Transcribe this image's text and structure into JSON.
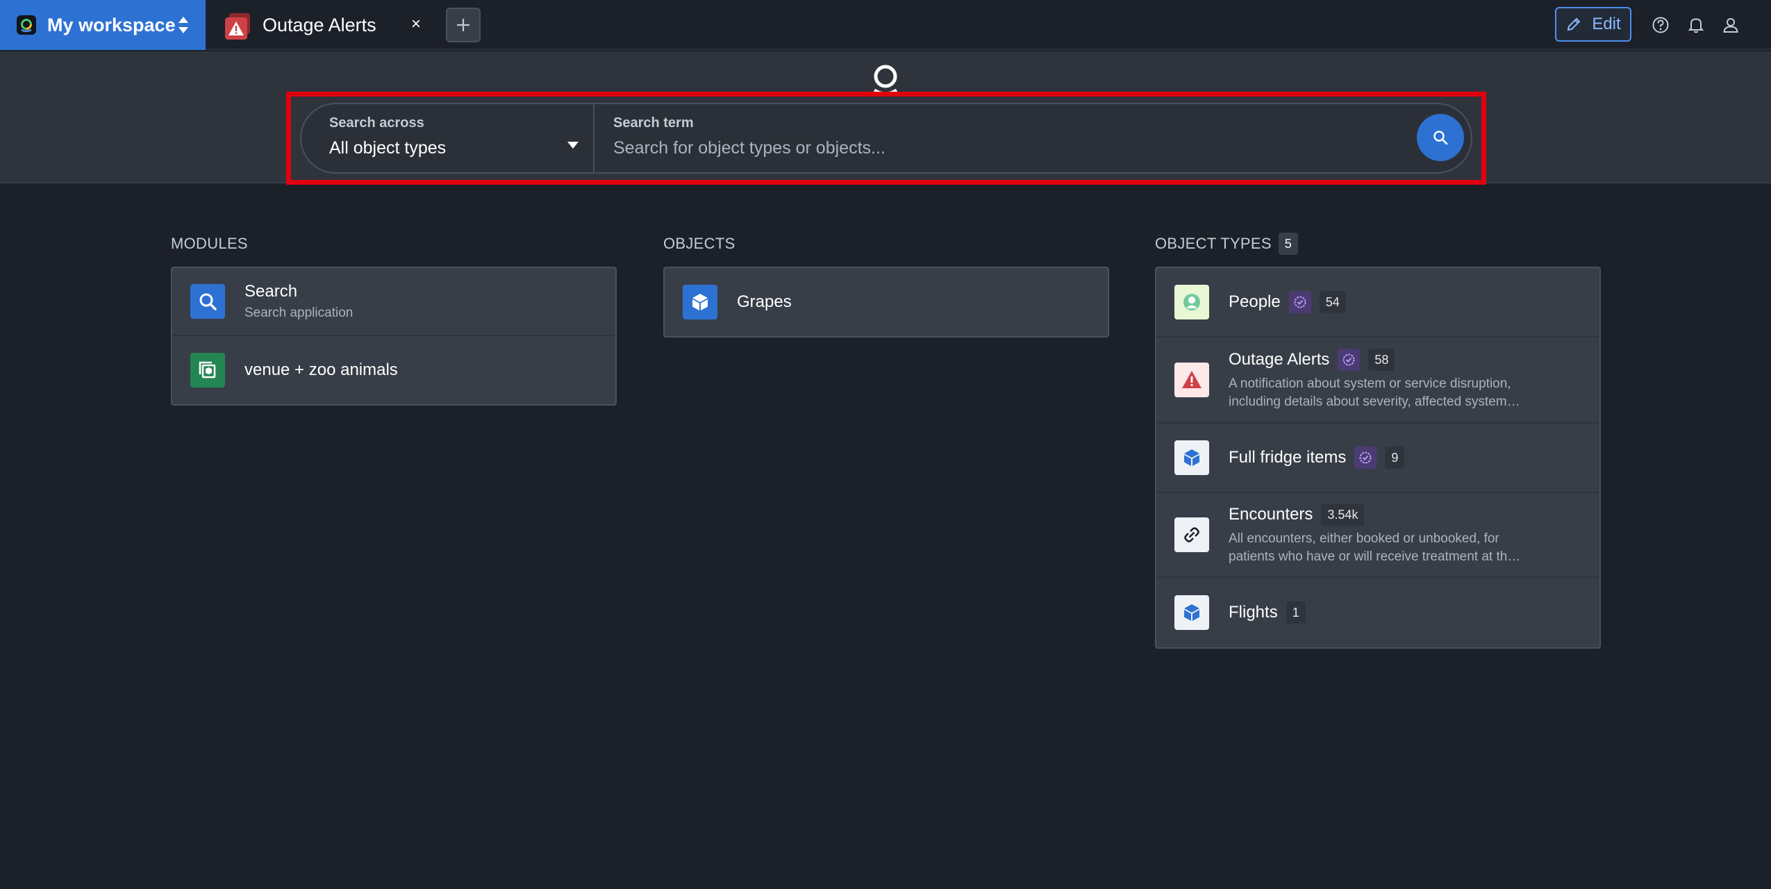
{
  "topbar": {
    "workspace_title": "My workspace",
    "tab_title": "Outage Alerts",
    "tab_close": "×",
    "new_tab": "+",
    "edit_label": "Edit"
  },
  "search": {
    "scope_label": "Search across",
    "scope_value": "All object types",
    "term_label": "Search term",
    "term_placeholder": "Search for object types or objects...",
    "term_value": ""
  },
  "modules": {
    "heading": "MODULES",
    "items": [
      {
        "title": "Search",
        "subtitle": "Search application",
        "icon": "search-icon",
        "color": "#2d72d2"
      },
      {
        "title": "venue + zoo animals",
        "icon": "module-icon",
        "color": "#238551"
      }
    ]
  },
  "objects": {
    "heading": "OBJECTS",
    "items": [
      {
        "title": "Grapes",
        "icon": "cube-icon",
        "color": "#2d72d2"
      }
    ]
  },
  "object_types": {
    "heading": "OBJECT TYPES",
    "count": "5",
    "items": [
      {
        "title": "People",
        "verified": true,
        "count": "54",
        "icon": "person-icon"
      },
      {
        "title": "Outage Alerts",
        "verified": true,
        "count": "58",
        "icon": "warning-icon",
        "description_line1": "A notification about system or service disruption,",
        "description_line2": "including details about severity, affected system…"
      },
      {
        "title": "Full fridge items",
        "verified": true,
        "count": "9",
        "icon": "cube-icon"
      },
      {
        "title": "Encounters",
        "verified": false,
        "count": "3.54k",
        "icon": "link-icon",
        "description_line1": "All encounters, either booked or unbooked, for",
        "description_line2": "patients who have or will receive treatment at th…"
      },
      {
        "title": "Flights",
        "verified": false,
        "count": "1",
        "icon": "cube-icon"
      }
    ]
  },
  "colors": {
    "accent": "#2d72d2",
    "highlight_frame": "#e0000f",
    "background": "#1c2029"
  }
}
